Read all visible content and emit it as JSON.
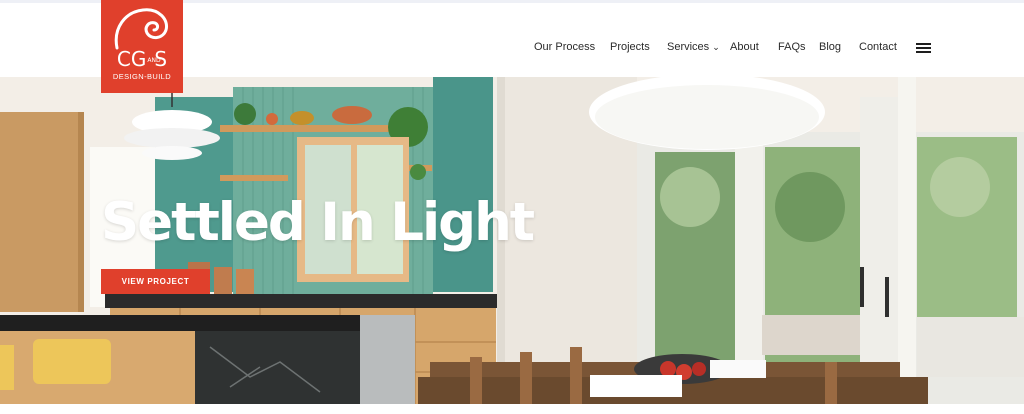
{
  "brand": {
    "mark_left": "CG",
    "mark_and": "AND",
    "mark_right": "S",
    "subtitle": "DESIGN-BUILD"
  },
  "nav": {
    "items": [
      {
        "label": "Our Process"
      },
      {
        "label": "Projects"
      },
      {
        "label": "Services",
        "has_dropdown": true
      },
      {
        "label": "About"
      },
      {
        "label": "FAQs"
      },
      {
        "label": "Blog"
      },
      {
        "label": "Contact"
      }
    ],
    "menu_icon": "hamburger-menu-icon",
    "dropdown_icon": "chevron-down-icon"
  },
  "hero": {
    "title": "Settled In Light",
    "cta_label": "VIEW PROJECT"
  },
  "colors": {
    "brand_red": "#e0402c",
    "nav_text": "#2b2b2b",
    "cabinet_teal": "#4f9a8e"
  }
}
